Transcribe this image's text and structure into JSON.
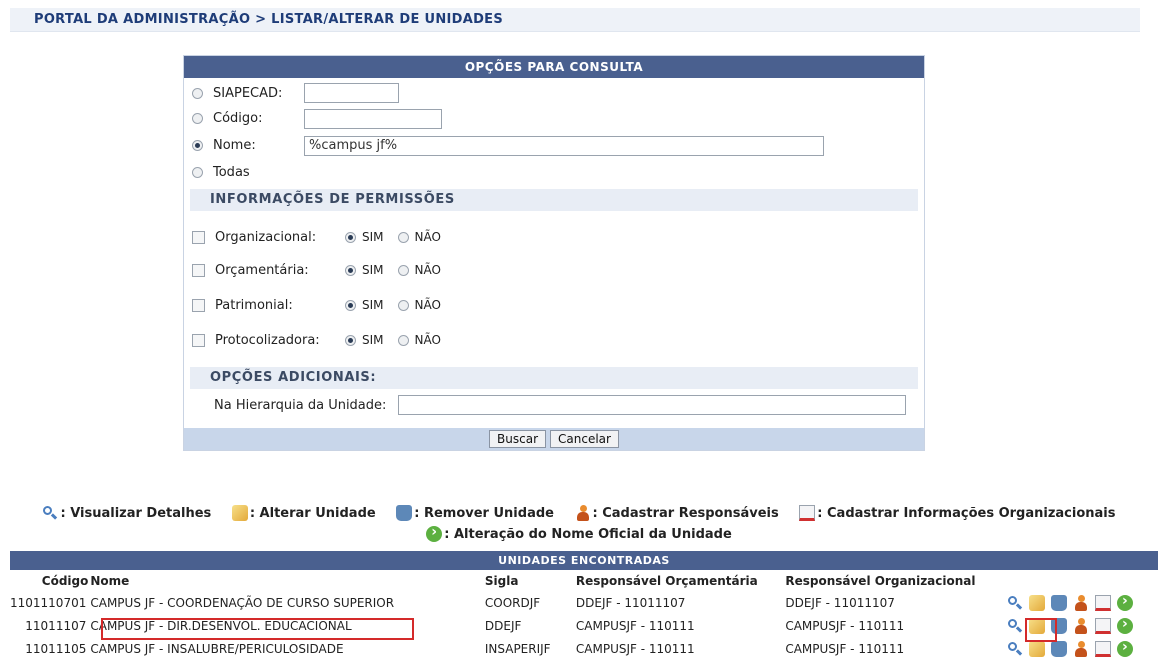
{
  "breadcrumb": "PORTAL DA ADMINISTRAÇÃO > LISTAR/ALTERAR DE UNIDADES",
  "form": {
    "caption": "OPÇÕES PARA CONSULTA",
    "siapecad_label": "SIAPECAD:",
    "siapecad_value": "",
    "codigo_label": "Código:",
    "codigo_value": "",
    "nome_label": "Nome:",
    "nome_value": "%campus jf%",
    "todas_label": "Todas",
    "perm_section": "INFORMAÇÕES DE PERMISSÕES",
    "permissions": [
      {
        "label": "Organizacional:",
        "sim": "SIM",
        "nao": "NÃO"
      },
      {
        "label": "Orçamentária:",
        "sim": "SIM",
        "nao": "NÃO"
      },
      {
        "label": "Patrimonial:",
        "sim": "SIM",
        "nao": "NÃO"
      },
      {
        "label": "Protocolizadora:",
        "sim": "SIM",
        "nao": "NÃO"
      }
    ],
    "adicionais_section": "OPÇÕES ADICIONAIS:",
    "hierarquia_label": "Na Hierarquia da Unidade:",
    "hierarquia_value": "",
    "buscar_label": "Buscar",
    "cancelar_label": "Cancelar"
  },
  "legend": {
    "visualizar": ": Visualizar Detalhes",
    "alterar": ": Alterar Unidade",
    "remover": ": Remover Unidade",
    "responsaveis": ": Cadastrar Responsáveis",
    "informacoes": ": Cadastrar Informações Organizacionais",
    "nome_oficial": ": Alteração do Nome Oficial da Unidade"
  },
  "results": {
    "caption": "UNIDADES ENCONTRADAS",
    "headers": [
      "Código",
      "Nome",
      "Sigla",
      "Responsável Orçamentária",
      "Responsável Organizacional"
    ],
    "rows": [
      {
        "codigo": "1101110701",
        "nome": "CAMPUS JF - COORDENAÇÃO DE CURSO SUPERIOR",
        "sigla": "COORDJF",
        "orc": "DDEJF - 11011107",
        "org": "DDEJF - 11011107"
      },
      {
        "codigo": "11011107",
        "nome": "CAMPUS JF - DIR.DESENVOL. EDUCACIONAL",
        "sigla": "DDEJF",
        "orc": "CAMPUSJF - 110111",
        "org": "CAMPUSJF - 110111"
      },
      {
        "codigo": "11011105",
        "nome": "CAMPUS JF - INSALUBRE/PERICULOSIDADE",
        "sigla": "INSAPERIJF",
        "orc": "CAMPUSJF - 110111",
        "org": "CAMPUSJF - 110111"
      }
    ]
  }
}
